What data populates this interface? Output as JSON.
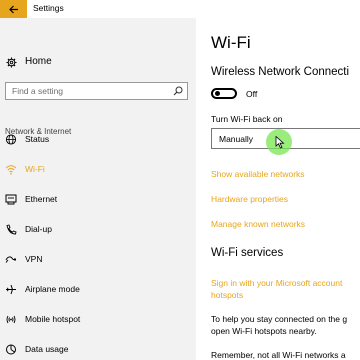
{
  "window": {
    "title": "Settings",
    "accent": "#e7a51d",
    "back_icon": "back-arrow-icon"
  },
  "sidebar": {
    "home_label": "Home",
    "search_placeholder": "Find a setting",
    "section_label": "Network & Internet",
    "items": [
      {
        "label": "Status",
        "icon": "globe-icon"
      },
      {
        "label": "Wi-Fi",
        "icon": "wifi-icon",
        "active": true
      },
      {
        "label": "Ethernet",
        "icon": "ethernet-icon"
      },
      {
        "label": "Dial-up",
        "icon": "phone-icon"
      },
      {
        "label": "VPN",
        "icon": "vpn-icon"
      },
      {
        "label": "Airplane mode",
        "icon": "airplane-icon"
      },
      {
        "label": "Mobile hotspot",
        "icon": "hotspot-icon"
      },
      {
        "label": "Data usage",
        "icon": "data-usage-icon"
      }
    ]
  },
  "content": {
    "page_title": "Wi-Fi",
    "wireless_heading": "Wireless Network Connecti",
    "toggle_state": "Off",
    "turn_back_on_label": "Turn Wi-Fi back on",
    "turn_back_on_value": "Manually",
    "links": [
      "Show available networks",
      "Hardware properties",
      "Manage known networks"
    ],
    "services_heading": "Wi-Fi services",
    "services_link_line1": "Sign in with your Microsoft account",
    "services_link_line2": "hotspots",
    "para1_line1": "To help you stay connected on the g",
    "para1_line2": "open Wi-Fi hotspots nearby.",
    "para2_line1": "Remember, not all Wi-Fi networks a"
  }
}
